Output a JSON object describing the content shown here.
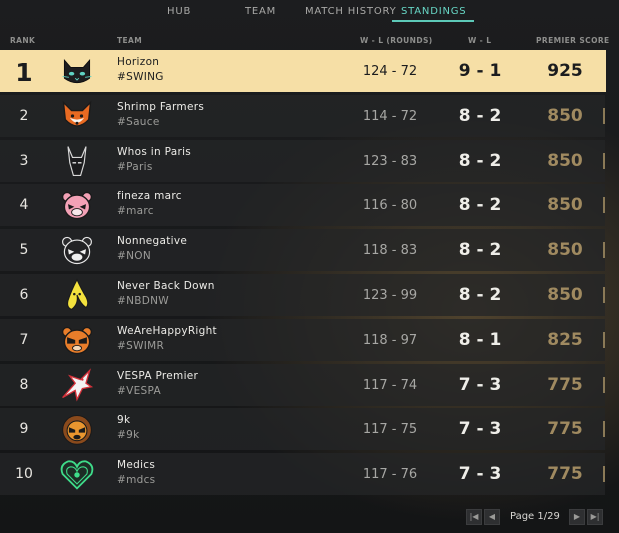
{
  "tabs": [
    {
      "label": "HUB"
    },
    {
      "label": "TEAM"
    },
    {
      "label": "MATCH HISTORY"
    },
    {
      "label": "STANDINGS"
    }
  ],
  "active_tab": "STANDINGS",
  "columns": {
    "rank": "RANK",
    "team": "TEAM",
    "rounds": "W - L (ROUNDS)",
    "wl": "W - L",
    "score": "PREMIER SCORE"
  },
  "rows": [
    {
      "rank": "1",
      "name": "Horizon",
      "tag": "#SWING",
      "rounds": "124 - 72",
      "wl": "9 - 1",
      "score": "925",
      "logo": "cat-icon",
      "highlight": true
    },
    {
      "rank": "2",
      "name": "Shrimp Farmers",
      "tag": "#Sauce",
      "rounds": "114 - 72",
      "wl": "8 - 2",
      "score": "850",
      "logo": "fox-icon"
    },
    {
      "rank": "3",
      "name": "Whos in Paris",
      "tag": "#Paris",
      "rounds": "123 - 83",
      "wl": "8 - 2",
      "score": "850",
      "logo": "anubis-icon"
    },
    {
      "rank": "4",
      "name": "fineza marc",
      "tag": "#marc",
      "rounds": "116 - 80",
      "wl": "8 - 2",
      "score": "850",
      "logo": "pink-bear-icon"
    },
    {
      "rank": "5",
      "name": "Nonnegative",
      "tag": "#NON",
      "rounds": "118 - 83",
      "wl": "8 - 2",
      "score": "850",
      "logo": "dark-bear-icon"
    },
    {
      "rank": "6",
      "name": "Never Back Down",
      "tag": "#NBDNW",
      "rounds": "123 - 99",
      "wl": "8 - 2",
      "score": "850",
      "logo": "banana-icon"
    },
    {
      "rank": "7",
      "name": "WeAreHappyRight",
      "tag": "#SWIMR",
      "rounds": "118 - 97",
      "wl": "8 - 1",
      "score": "825",
      "logo": "orange-bear-icon"
    },
    {
      "rank": "8",
      "name": "VESPA Premier",
      "tag": "#VESPA",
      "rounds": "117 - 74",
      "wl": "7 - 3",
      "score": "775",
      "logo": "bird-icon"
    },
    {
      "rank": "9",
      "name": "9k",
      "tag": "#9k",
      "rounds": "117 - 75",
      "wl": "7 - 3",
      "score": "775",
      "logo": "lion-icon"
    },
    {
      "rank": "10",
      "name": "Medics",
      "tag": "#mdcs",
      "rounds": "117 - 76",
      "wl": "7 - 3",
      "score": "775",
      "logo": "heart-icon"
    }
  ],
  "pagination": {
    "label": "Page 1/29"
  },
  "colors": {
    "accent": "#5dc9b8",
    "highlight_row": "#f6dfa6",
    "score_gold": "#a08a60"
  }
}
